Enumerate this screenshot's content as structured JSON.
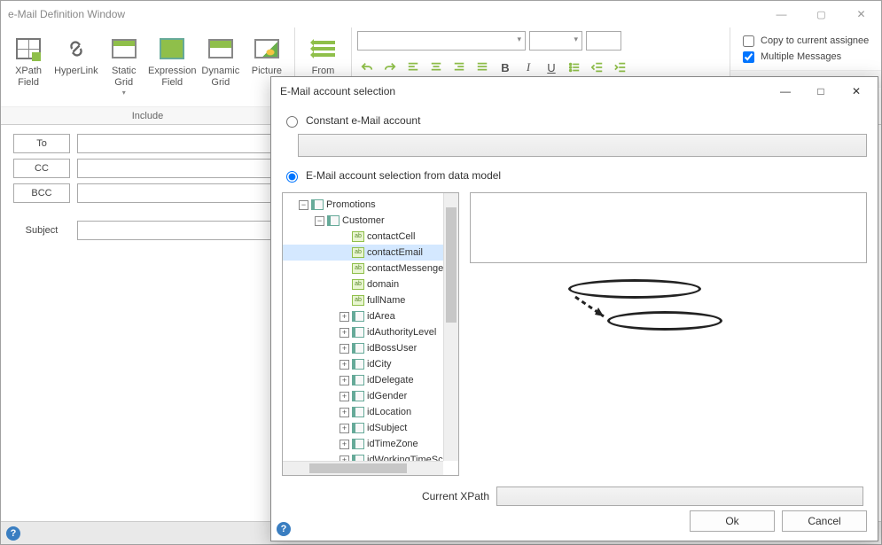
{
  "window": {
    "title": "e-Mail Definition Window"
  },
  "ribbon": {
    "include_group_title": "Include",
    "from_group_title": "",
    "xpath_field": "XPath\nField",
    "hyperlink": "HyperLink",
    "static_grid": "Static\nGrid",
    "static_arrow": "▾",
    "expression_field": "Expression\nField",
    "dynamic_grid": "Dynamic\nGrid",
    "picture": "Picture",
    "from": "From",
    "copy_assignee": "Copy to current assignee",
    "multiple_messages": "Multiple Messages"
  },
  "form": {
    "to": "To",
    "cc": "CC",
    "bcc": "BCC",
    "subject": "Subject"
  },
  "dialog": {
    "title": "E-Mail account selection",
    "constant_radio": "Constant e-Mail account",
    "datamodel_radio": "E-Mail account selection from data model",
    "current_xpath_label": "Current XPath",
    "current_xpath_value": "",
    "ok": "Ok",
    "cancel": "Cancel",
    "tree": {
      "root": "Promotions",
      "customer": "Customer",
      "items": [
        {
          "label": "contactCell",
          "type": "attr"
        },
        {
          "label": "contactEmail",
          "type": "attr",
          "selected": true
        },
        {
          "label": "contactMessenge",
          "type": "attr"
        },
        {
          "label": "domain",
          "type": "attr"
        },
        {
          "label": "fullName",
          "type": "attr"
        },
        {
          "label": "idArea",
          "type": "ent"
        },
        {
          "label": "idAuthorityLevel",
          "type": "ent"
        },
        {
          "label": "idBossUser",
          "type": "ent"
        },
        {
          "label": "idCity",
          "type": "ent"
        },
        {
          "label": "idDelegate",
          "type": "ent"
        },
        {
          "label": "idGender",
          "type": "ent"
        },
        {
          "label": "idLocation",
          "type": "ent"
        },
        {
          "label": "idSubject",
          "type": "ent"
        },
        {
          "label": "idTimeZone",
          "type": "ent"
        },
        {
          "label": "idWorkingTimeSc",
          "type": "ent"
        }
      ]
    }
  }
}
